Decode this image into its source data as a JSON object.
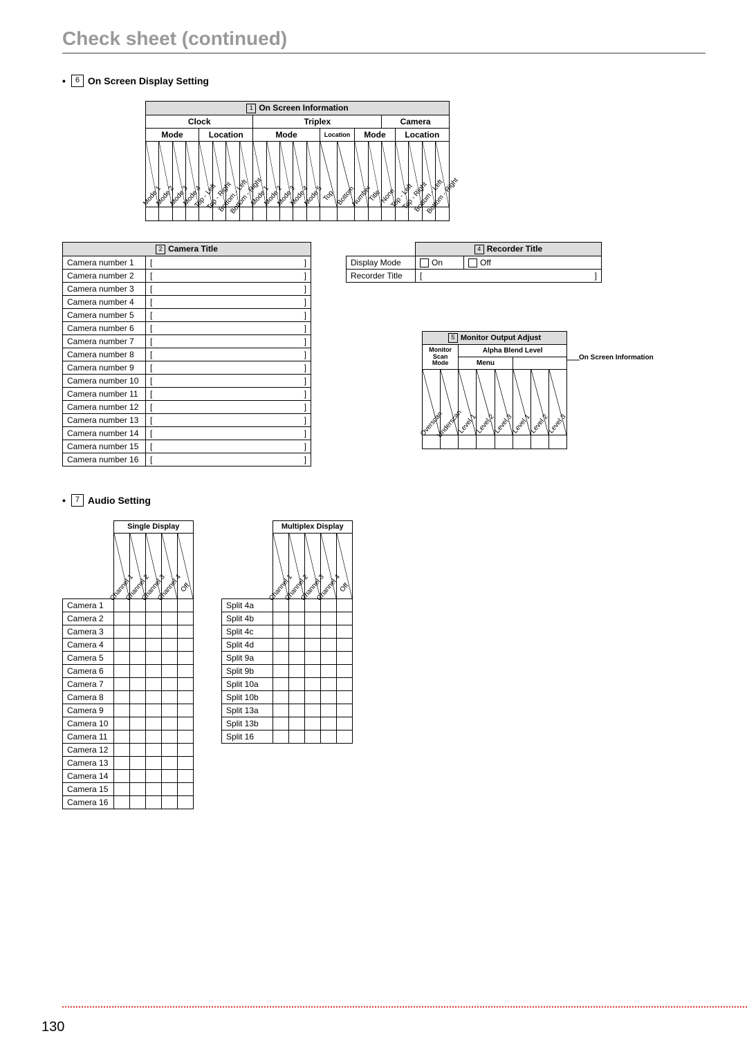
{
  "title": "Check sheet (continued)",
  "page_number": "130",
  "section6": {
    "num": "6",
    "label": "On Screen Display Setting",
    "table1": {
      "num": "1",
      "title": "On Screen Information",
      "groups": [
        "Clock",
        "Triplex",
        "Camera"
      ],
      "sub": [
        "Mode",
        "Location",
        "Mode",
        "Location",
        "Mode",
        "Location"
      ],
      "diag": [
        "Mode 1",
        "Mode 2",
        "Mode 3",
        "Mode 4",
        "Top - Left",
        "Top - Right",
        "Bottom - Left",
        "Bottom - Right",
        "Mode 1",
        "Mode 2",
        "Mode 3",
        "Mode 4",
        "Mode 5",
        "Top",
        "Bottom",
        "Number",
        "Title",
        "None",
        "Top - Left",
        "Top - Right",
        "Bottom - Left",
        "Bottom - Right"
      ]
    },
    "table2": {
      "num": "2",
      "title": "Camera Title",
      "rows": [
        "Camera number 1",
        "Camera number 2",
        "Camera number 3",
        "Camera number 4",
        "Camera number 5",
        "Camera number 6",
        "Camera number 7",
        "Camera number 8",
        "Camera number 9",
        "Camera number 10",
        "Camera number 11",
        "Camera number 12",
        "Camera number 13",
        "Camera number 14",
        "Camera number 15",
        "Camera number 16"
      ],
      "lbr": "[",
      "rbr": "]"
    },
    "table4": {
      "num": "4",
      "title": "Recorder Title",
      "r1": "Display Mode",
      "r1_on": "On",
      "r1_off": "Off",
      "r2": "Recorder Title",
      "lbr": "[",
      "rbr": "]"
    },
    "table5": {
      "num": "5",
      "title": "Monitor Output Adjust",
      "g1": "Monitor Scan Mode",
      "g2": "Alpha Blend Level",
      "g2a": "Menu",
      "g2b": "On Screen Information",
      "diag": [
        "Overscan",
        "Underscan",
        "Level 1",
        "Level 2",
        "Level 3",
        "Level 1",
        "Level 2",
        "Level 3"
      ]
    }
  },
  "section7": {
    "num": "7",
    "label": "Audio Setting",
    "single": {
      "title": "Single Display",
      "diag": [
        "Channel 1",
        "Channel 2",
        "Channel 3",
        "Channel 4",
        "Off"
      ],
      "rows": [
        "Camera 1",
        "Camera 2",
        "Camera 3",
        "Camera 4",
        "Camera 5",
        "Camera 6",
        "Camera 7",
        "Camera 8",
        "Camera 9",
        "Camera 10",
        "Camera 11",
        "Camera 12",
        "Camera 13",
        "Camera 14",
        "Camera 15",
        "Camera 16"
      ]
    },
    "multi": {
      "title": "Multiplex Display",
      "diag": [
        "Channel 1",
        "Channel 2",
        "Channel 3",
        "Channel 4",
        "Off"
      ],
      "rows": [
        "Split 4a",
        "Split 4b",
        "Split 4c",
        "Split 4d",
        "Split 9a",
        "Split 9b",
        "Split 10a",
        "Split 10b",
        "Split 13a",
        "Split 13b",
        "Split 16"
      ]
    }
  }
}
